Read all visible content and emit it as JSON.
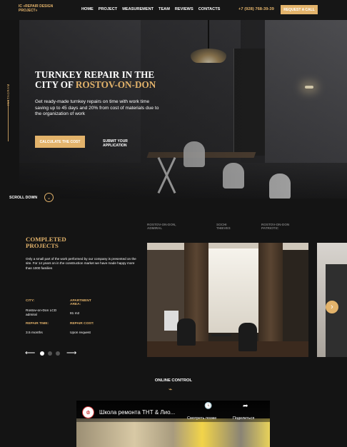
{
  "header": {
    "logo": "IC «REPAIR DESIGN PROJECT»",
    "nav": [
      "HOME",
      "PROJECT",
      "MEASUREMENT",
      "TEAM",
      "REVIEWS",
      "CONTACTS"
    ],
    "phone": "+7 (928) 768-39-39",
    "request_label": "REQUEST A CALL"
  },
  "rail": {
    "instagram": "INSTAGRAM"
  },
  "hero": {
    "title_line1": "TURNKEY REPAIR IN THE",
    "title_line2_a": "CITY OF ",
    "title_line2_b": "ROSTOV-ON-DON",
    "subtitle": "Get ready-made turnkey repairs on time with work time saving up to 45 days and 20% from cost of materials due to the organization of work",
    "calc_label": "CALCULATE THE COST",
    "submit_label": "SUBMIT YOUR APPLICATION",
    "scroll_label": "SCROLL DOWN"
  },
  "projects": {
    "tabs": [
      "ROSTOV-ON-DON, ADMIRAL",
      "SOCHI THIEVES",
      "ROSTOV-ON-DON PATRIOTIC"
    ],
    "title": "COMPLETED PROJECTS",
    "description": "Only a small part of the work performed by our company is presented on the site. For 14 years on in the construction market we have made happy more than 1000 families",
    "city_label": "CITY:",
    "city_value": "Rostov-on-Don LCD admiral",
    "area_label": "APARTMENT AREA:",
    "area_value": "81 m2",
    "time_label": "REPAIR TIME:",
    "time_value": "3.5 months",
    "cost_label": "REPAIR COST:",
    "cost_value": "Upon request",
    "slider_prev": "⟵",
    "slider_next": "⟶",
    "next_arrow": "›"
  },
  "online": {
    "title": "ONLINE CONTROL"
  },
  "video": {
    "title": "Школа ремонта ТНТ & Лио...",
    "watch_later": "Смотреть позже",
    "share": "Поделиться"
  },
  "colors": {
    "accent": "#e3b36b",
    "background": "#141414"
  }
}
